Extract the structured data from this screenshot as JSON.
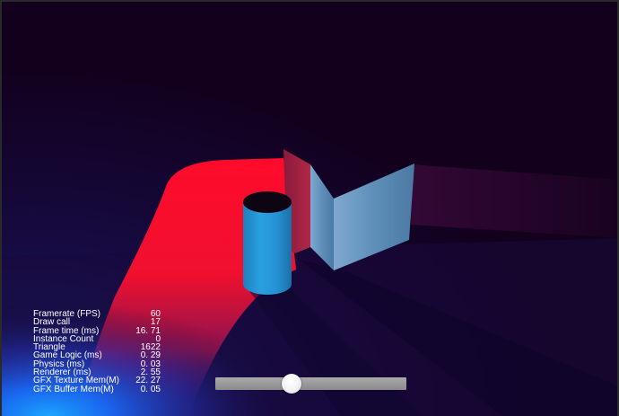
{
  "stats": [
    {
      "label": "Framerate (FPS)",
      "value": "60"
    },
    {
      "label": "Draw call",
      "value": "17"
    },
    {
      "label": "Frame time (ms)",
      "value": "16. 71"
    },
    {
      "label": "Instance Count",
      "value": "0"
    },
    {
      "label": "Triangle",
      "value": "1622"
    },
    {
      "label": "Game Logic (ms)",
      "value": "0. 29"
    },
    {
      "label": "Physics (ms)",
      "value": "0. 03"
    },
    {
      "label": "Renderer (ms)",
      "value": "2. 55"
    },
    {
      "label": "GFX Texture Mem(M)",
      "value": "22. 27"
    },
    {
      "label": "GFX Buffer Mem(M)",
      "value": "0. 05"
    }
  ],
  "slider": {
    "value": 0.4
  },
  "scene": {
    "background_color": "#12001c",
    "spotlight_color": "#ff0022",
    "blue_light_color": "#1a8cff",
    "cylinder_color": "#2596d8",
    "wall_color": "#5e95bd"
  }
}
